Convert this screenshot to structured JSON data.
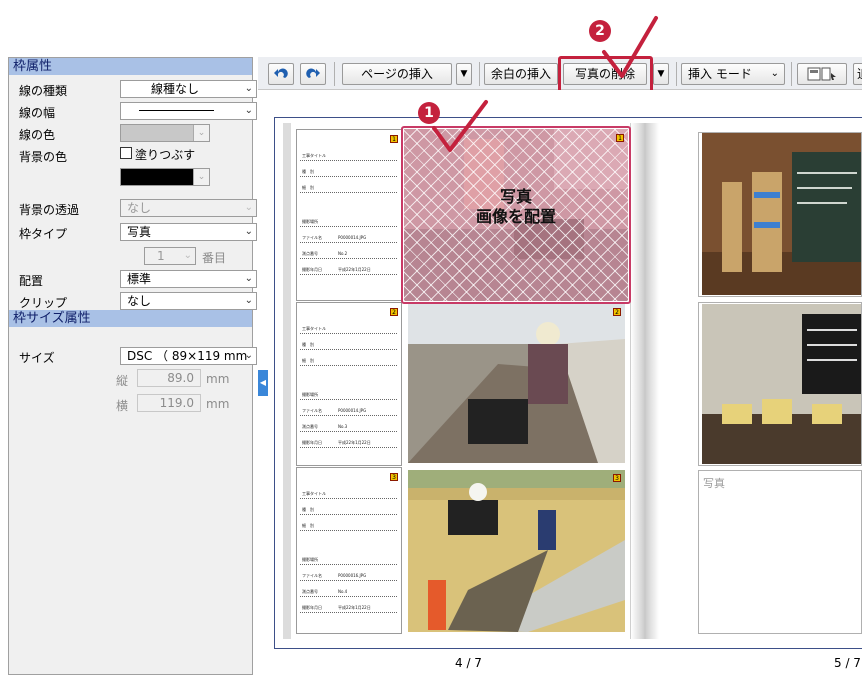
{
  "callouts": {
    "one": "1",
    "two": "2"
  },
  "left_panel": {
    "section_frame": "枠属性",
    "section_size": "枠サイズ属性",
    "rows": {
      "line_type": {
        "label": "線の種類",
        "value": "線種なし"
      },
      "line_width": {
        "label": "線の幅"
      },
      "line_color": {
        "label": "線の色"
      },
      "bg_color": {
        "label": "背景の色",
        "checkbox": "塗りつぶす"
      },
      "bg_transparency": {
        "label": "背景の透過",
        "value": "なし"
      },
      "frame_type": {
        "label": "枠タイプ",
        "value": "写真"
      },
      "index": {
        "value": "1",
        "suffix": "番目"
      },
      "placement": {
        "label": "配置",
        "value": "標準"
      },
      "clip": {
        "label": "クリップ",
        "value": "なし"
      },
      "size": {
        "label": "サイズ",
        "value": "DSC （ 89×119 mm"
      },
      "height": {
        "label": "縦",
        "value": "89.0",
        "unit": "mm"
      },
      "width": {
        "label": "横",
        "value": "119.0",
        "unit": "mm"
      }
    }
  },
  "toolbar": {
    "undo_icon": "undo-icon",
    "redo_icon": "redo-icon",
    "insert_page": "ページの挿入",
    "insert_margin": "余白の挿入",
    "delete_photo": "写真の削除",
    "insert_mode": "挿入 モード",
    "layout_icon": "layout-icon"
  },
  "document": {
    "placeholder_line1": "写真",
    "placeholder_line2": "画像を配置",
    "empty_frame_label": "写真",
    "left_page_number": "4 / 7",
    "right_page_number": "5 / 7",
    "badges": [
      "1",
      "2",
      "3"
    ],
    "info_labels": [
      "工事タイトル",
      "種　別",
      "細　別",
      "撮影場所",
      "ファイル名",
      "測点番号",
      "撮影年月日"
    ],
    "info_values": {
      "file_1": "P0000014.JPG",
      "file_2": "P0000014.JPG",
      "file_3": "P0000016.JPG",
      "station_1": "No.2",
      "station_2": "No.3",
      "station_3": "No.4",
      "date": "平成22年1月22日"
    }
  },
  "colors": {
    "accent": "#c4213d",
    "section_header_bg": "#a9c1e6",
    "selection_pink": "#e8a0b8",
    "spread_border": "#3d4f88"
  }
}
